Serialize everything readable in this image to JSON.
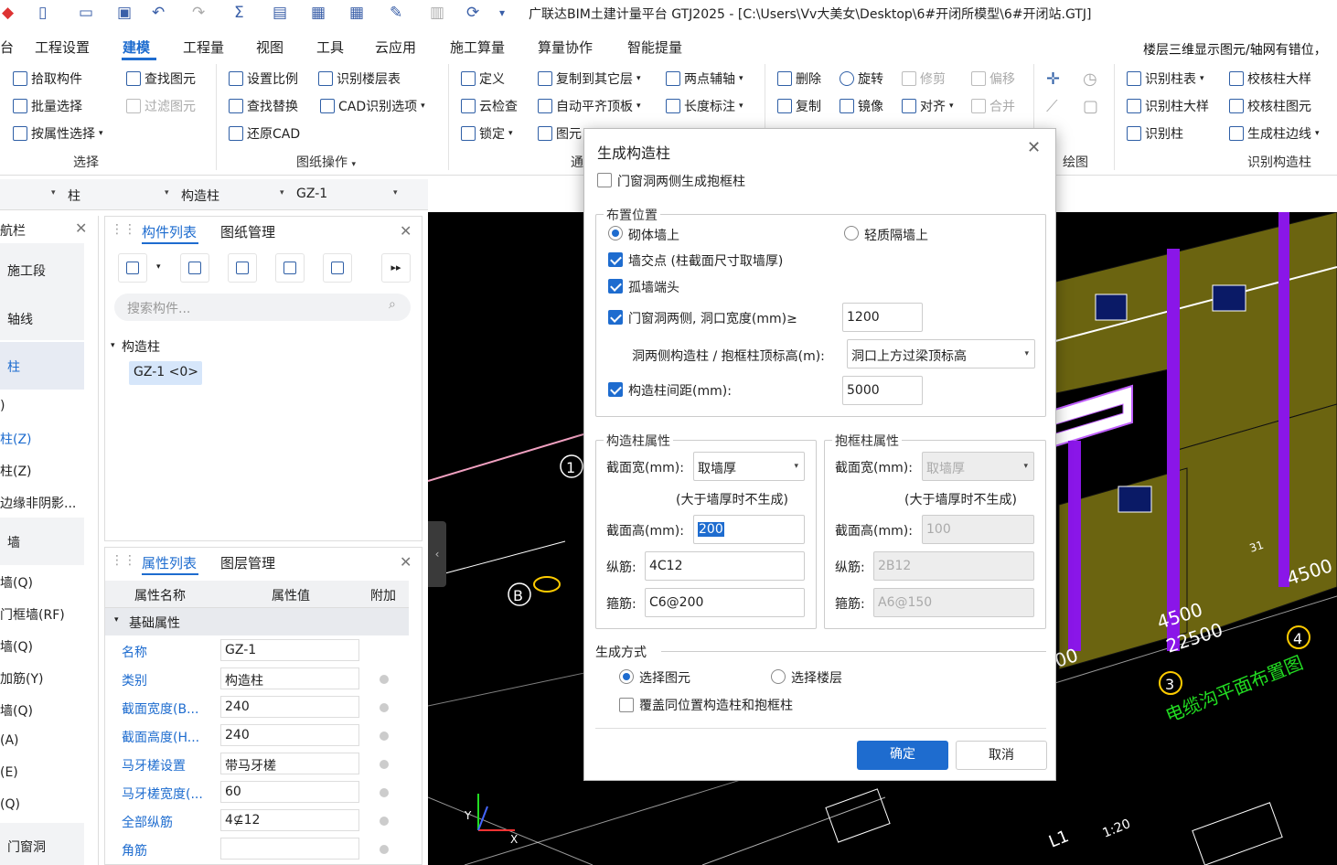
{
  "title_bar": {
    "window_title": "广联达BIM土建计量平台 GTJ2025 - [C:\\Users\\Vv大美女\\Desktop\\6#开闭所模型\\6#开闭站.GTJ]"
  },
  "menu": {
    "items": [
      "台",
      "工程设置",
      "建模",
      "工程量",
      "视图",
      "工具",
      "云应用",
      "施工算量",
      "算量协作",
      "智能提量"
    ],
    "active": "建模",
    "right_text": "楼层三维显示图元/轴网有错位，"
  },
  "ribbon": {
    "select_group": {
      "items": [
        "拾取构件",
        "批量选择",
        "按属性选择",
        "查找图元",
        "过滤图元"
      ],
      "label": "选择"
    },
    "drawing_group": {
      "items": [
        "设置比例",
        "识别楼层表",
        "查找替换",
        "CAD识别选项",
        "还原CAD"
      ],
      "label": "图纸操作"
    },
    "general_group": {
      "items": [
        "定义",
        "复制到其它层",
        "两点辅轴",
        "云检查",
        "自动平齐顶板",
        "长度标注",
        "锁定",
        "图元"
      ],
      "label": "通"
    },
    "modify_group": {
      "items": [
        "删除",
        "旋转",
        "修剪",
        "偏移",
        "复制",
        "镜像",
        "对齐",
        "合并"
      ]
    },
    "draw_group": {
      "label": "绘图"
    },
    "recognize_group": {
      "items": [
        "识别柱表",
        "校核柱大样",
        "识别柱大样",
        "校核柱图元",
        "识别柱",
        "生成柱边线"
      ],
      "label": "识别构造柱"
    }
  },
  "selector_bar": {
    "items": [
      "柱",
      "构造柱",
      "GZ-1"
    ]
  },
  "left_nav": {
    "title": "航栏",
    "items": [
      "施工段",
      "轴线",
      "柱",
      ")",
      "柱(Z)",
      "柱(Z)",
      "边缘非阴影...",
      "墙",
      "墙(Q)",
      "门框墙(RF)",
      "墙(Q)",
      "加筋(Y)",
      "墙(Q)",
      "(A)",
      "(E)",
      "(Q)",
      "门窗洞"
    ]
  },
  "component_panel": {
    "tabs": [
      "构件列表",
      "图纸管理"
    ],
    "search_placeholder": "搜索构件...",
    "tree_root": "构造柱",
    "tree_item": "GZ-1 <0>"
  },
  "property_panel": {
    "tabs": [
      "属性列表",
      "图层管理"
    ],
    "headers": [
      "属性名称",
      "属性值",
      "附加"
    ],
    "section": "基础属性",
    "rows": [
      {
        "name": "名称",
        "value": "GZ-1"
      },
      {
        "name": "类别",
        "value": "构造柱"
      },
      {
        "name": "截面宽度(B...",
        "value": "240"
      },
      {
        "name": "截面高度(H...",
        "value": "240"
      },
      {
        "name": "马牙槎设置",
        "value": "带马牙槎"
      },
      {
        "name": "马牙槎宽度(...",
        "value": "60"
      },
      {
        "name": "全部纵筋",
        "value": "4⊈12"
      },
      {
        "name": "角筋",
        "value": ""
      }
    ]
  },
  "canvas": {
    "labels": [
      "1",
      "B",
      "4500",
      "4500",
      "22500",
      "00",
      "4",
      "3",
      "31",
      "电缆沟平面布置图",
      "1:20",
      "L1"
    ],
    "axis_labels": [
      "Y",
      "X"
    ]
  },
  "dialog": {
    "title": "生成构造柱",
    "door_window_frame": {
      "label": "门窗洞两侧生成抱框柱",
      "checked": false
    },
    "placement": {
      "title": "布置位置",
      "masonry": {
        "label": "砌体墙上",
        "selected": true
      },
      "light_partition": {
        "label": "轻质隔墙上",
        "selected": false
      },
      "wall_intersection": {
        "label": "墙交点 (柱截面尺寸取墙厚)",
        "checked": true
      },
      "isolated_wall_end": {
        "label": "孤墙端头",
        "checked": true
      },
      "opening_sides": {
        "label": "门窗洞两侧, 洞口宽度(mm)≥",
        "checked": true,
        "value": "1200"
      },
      "top_elevation": {
        "label": "洞两侧构造柱 / 抱框柱顶标高(m):",
        "value": "洞口上方过梁顶标高"
      },
      "spacing": {
        "label": "构造柱间距(mm):",
        "checked": true,
        "value": "5000"
      }
    },
    "gz_props": {
      "title": "构造柱属性",
      "width_label": "截面宽(mm):",
      "width_value": "取墙厚",
      "note": "(大于墙厚时不生成)",
      "height_label": "截面高(mm):",
      "height_value": "200",
      "long_bar_label": "纵筋:",
      "long_bar_value": "4C12",
      "stirrup_label": "箍筋:",
      "stirrup_value": "C6@200"
    },
    "frame_props": {
      "title": "抱框柱属性",
      "width_label": "截面宽(mm):",
      "width_value": "取墙厚",
      "note": "(大于墙厚时不生成)",
      "height_label": "截面高(mm):",
      "height_value": "100",
      "long_bar_label": "纵筋:",
      "long_bar_value": "2B12",
      "stirrup_label": "箍筋:",
      "stirrup_value": "A6@150"
    },
    "generate_mode": {
      "title": "生成方式",
      "select_elements": {
        "label": "选择图元",
        "selected": true
      },
      "select_floors": {
        "label": "选择楼层",
        "selected": false
      },
      "overwrite": {
        "label": "覆盖同位置构造柱和抱框柱",
        "checked": false
      }
    },
    "ok_label": "确定",
    "cancel_label": "取消"
  },
  "colors": {
    "accent": "#1e6ccf",
    "wall": "#6b6410",
    "column": "#8a16e8",
    "canvas_bg": "#000000"
  }
}
